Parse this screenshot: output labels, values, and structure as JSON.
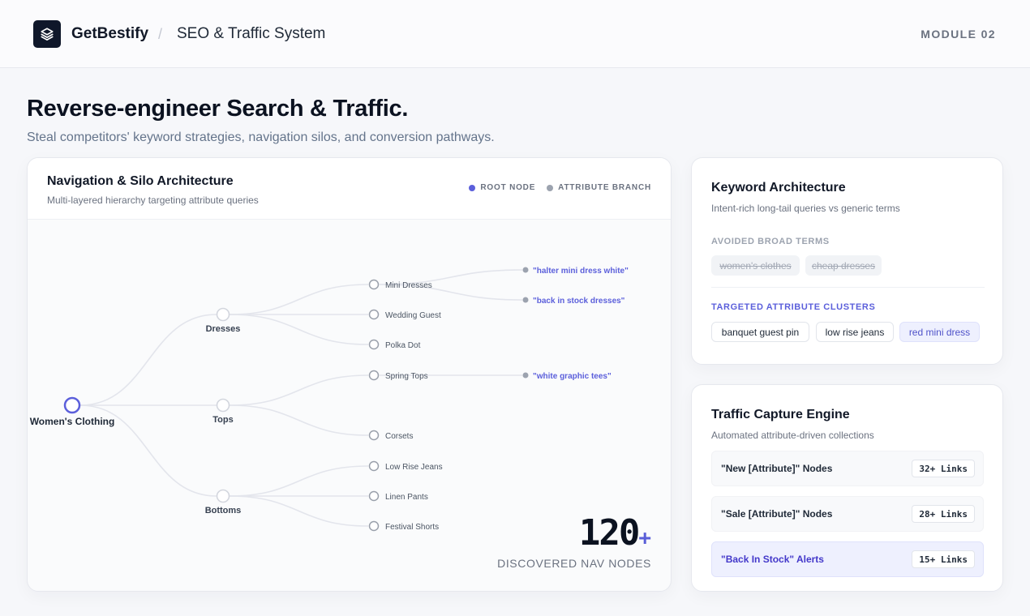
{
  "header": {
    "brand": "GetBestify",
    "separator": "/",
    "system_title": "SEO & Traffic System",
    "module": "MODULE 02",
    "logo_icon": "layers-icon"
  },
  "hero": {
    "title": "Reverse-engineer Search & Traffic.",
    "subtitle": "Steal competitors' keyword strategies, navigation silos, and conversion pathways."
  },
  "nav_architecture": {
    "title": "Navigation & Silo Architecture",
    "subtitle": "Multi-layered hierarchy targeting attribute queries",
    "legend": [
      {
        "label": "ROOT NODE",
        "color": "#5b5fdb"
      },
      {
        "label": "ATTRIBUTE BRANCH",
        "color": "#9ca3af"
      }
    ],
    "tree": {
      "root": "Women's Clothing",
      "branches": [
        {
          "label": "Dresses",
          "children": [
            {
              "label": "Mini Dresses",
              "queries": [
                "\"halter mini dress white\"",
                "\"back in stock dresses\""
              ]
            },
            {
              "label": "Wedding Guest",
              "queries": []
            },
            {
              "label": "Polka Dot",
              "queries": []
            }
          ]
        },
        {
          "label": "Tops",
          "children": [
            {
              "label": "Spring Tops",
              "queries": [
                "\"white graphic tees\""
              ]
            },
            {
              "label": "Corsets",
              "queries": []
            }
          ]
        },
        {
          "label": "Bottoms",
          "children": [
            {
              "label": "Low Rise Jeans",
              "queries": []
            },
            {
              "label": "Linen Pants",
              "queries": []
            },
            {
              "label": "Festival Shorts",
              "queries": []
            }
          ]
        }
      ]
    },
    "count": "120",
    "count_suffix": "+",
    "count_label": "DISCOVERED NAV NODES"
  },
  "keyword_architecture": {
    "title": "Keyword Architecture",
    "subtitle": "Intent-rich long-tail queries vs generic terms",
    "avoided_label": "AVOIDED BROAD TERMS",
    "avoided": [
      "women's clothes",
      "cheap dresses"
    ],
    "targeted_label": "TARGETED ATTRIBUTE CLUSTERS",
    "targeted": [
      "banquet guest pin",
      "low rise jeans",
      "red mini dress"
    ]
  },
  "traffic_engine": {
    "title": "Traffic Capture Engine",
    "subtitle": "Automated attribute-driven collections",
    "rows": [
      {
        "label": "\"New [Attribute]\" Nodes",
        "badge": "32+ Links"
      },
      {
        "label": "\"Sale [Attribute]\" Nodes",
        "badge": "28+ Links"
      },
      {
        "label": "\"Back In Stock\" Alerts",
        "badge": "15+ Links"
      }
    ]
  },
  "colors": {
    "accent": "#5b5fdb",
    "root_ring": "#5b5fdb",
    "branch_dot": "#9ca3af",
    "query_text": "#5b5fdb"
  }
}
